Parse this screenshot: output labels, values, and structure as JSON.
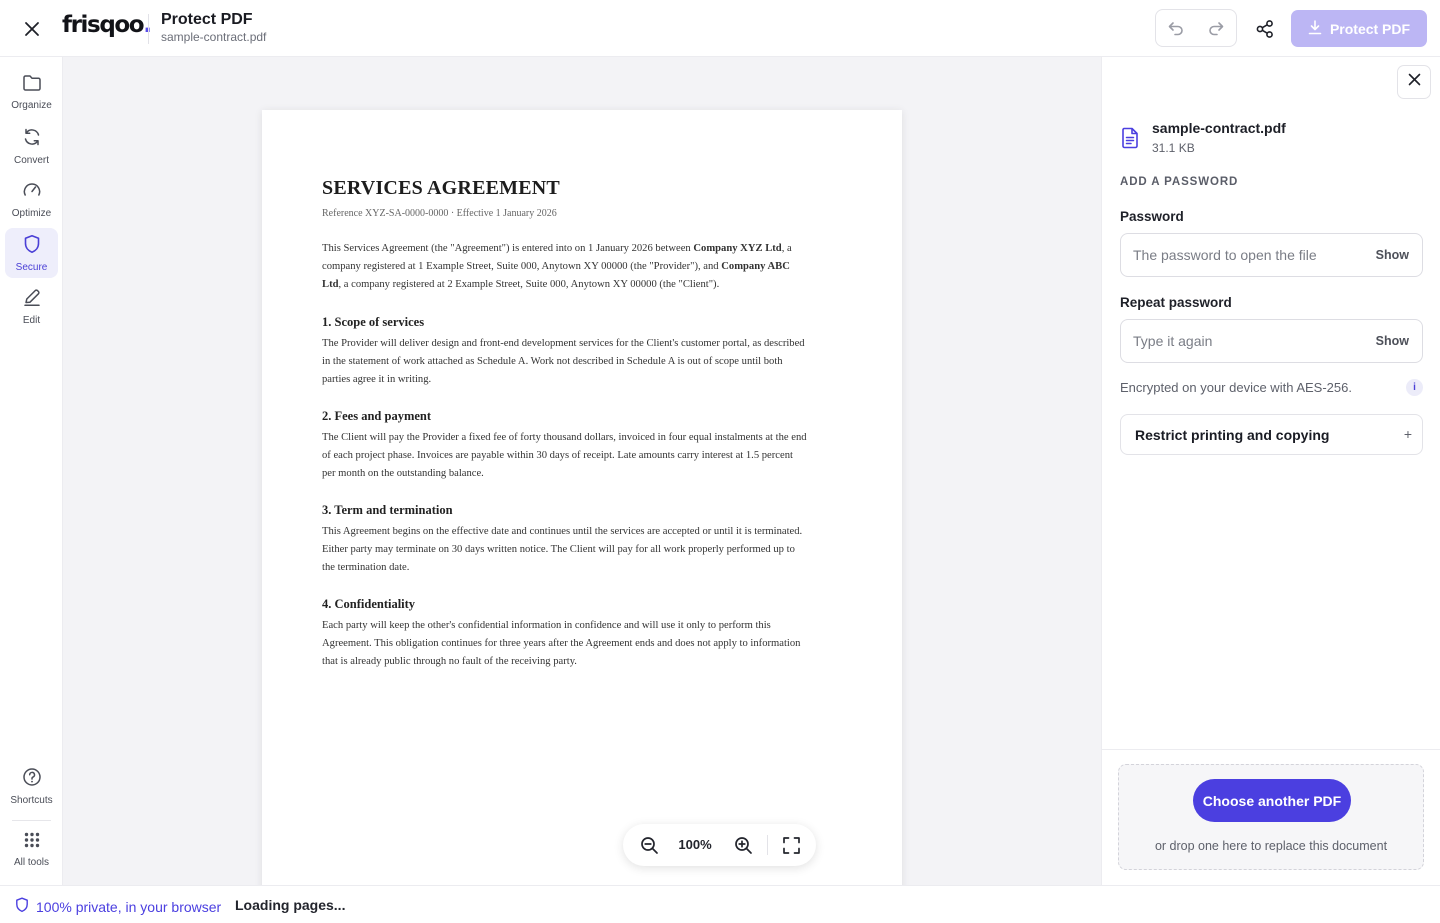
{
  "header": {
    "logo": "frisqoo",
    "title": "Protect PDF",
    "subtitle": "sample-contract.pdf",
    "primary_action": "Protect PDF",
    "icons": [
      "close-icon",
      "undo-icon",
      "redo-icon",
      "share-icon",
      "download-icon"
    ]
  },
  "rail": {
    "items": [
      {
        "label": "Organize",
        "icon": "folder-icon"
      },
      {
        "label": "Convert",
        "icon": "refresh-icon"
      },
      {
        "label": "Optimize",
        "icon": "gauge-icon"
      },
      {
        "label": "Secure",
        "icon": "shield-icon",
        "active": true
      },
      {
        "label": "Edit",
        "icon": "pencil-icon"
      }
    ],
    "bottom": [
      {
        "label": "Shortcuts",
        "icon": "help-circle-icon"
      },
      {
        "label": "All tools",
        "icon": "grid-icon"
      }
    ]
  },
  "document": {
    "title": "SERVICES AGREEMENT",
    "reference": "Reference XYZ-SA-0000-0000 · Effective 1 January 2026",
    "intro_lines": [
      [
        "This Services Agreement (the \"Agreement\") is entered into on 1 January 2026 between ",
        "Company XYZ Ltd",
        ", a"
      ],
      [
        "company registered at 1 Example Street, Suite 000, Anytown XY 00000 (the \"Provider\"), and ",
        "Company ABC",
        ""
      ],
      [
        "",
        "Ltd",
        ", a company registered at 2 Example Street, Suite 000, Anytown XY 00000 (the \"Client\")."
      ]
    ],
    "sections": [
      {
        "heading": "1. Scope of services",
        "lines": [
          "The Provider will deliver design and front-end development services for the Client's customer portal, as described",
          "in the statement of work attached as Schedule A. Work not described in Schedule A is out of scope until both",
          "parties agree it in writing."
        ]
      },
      {
        "heading": "2. Fees and payment",
        "lines": [
          "The Client will pay the Provider a fixed fee of forty thousand dollars, invoiced in four equal instalments at the end",
          "of each project phase. Invoices are payable within 30 days of receipt. Late amounts carry interest at 1.5 percent",
          "per month on the outstanding balance."
        ]
      },
      {
        "heading": "3. Term and termination",
        "lines": [
          "This Agreement begins on the effective date and continues until the services are accepted or until it is terminated.",
          "Either party may terminate on 30 days written notice. The Client will pay for all work properly performed up to",
          "the termination date."
        ]
      },
      {
        "heading": "4. Confidentiality",
        "lines": [
          "Each party will keep the other's confidential information in confidence and will use it only to perform this",
          "Agreement. This obligation continues for three years after the Agreement ends and does not apply to information",
          "that is already public through no fault of the receiving party."
        ]
      }
    ]
  },
  "zoom": {
    "level": "100%",
    "icons": [
      "zoom-out-icon",
      "zoom-in-icon",
      "fullscreen-icon"
    ]
  },
  "panel": {
    "file_name": "sample-contract.pdf",
    "file_size": "31.1 KB",
    "section_title": "ADD A PASSWORD",
    "password_label": "Password",
    "password_placeholder": "The password to open the file",
    "repeat_label": "Repeat password",
    "repeat_placeholder": "Type it again",
    "show_label": "Show",
    "encryption_note": "Encrypted on your device with AES-256.",
    "info_glyph": "i",
    "restrict_label": "Restrict printing and copying",
    "restrict_toggle": "+",
    "choose_button": "Choose another PDF",
    "drop_hint": "or drop one here to replace this document"
  },
  "status": {
    "privacy": "100% private, in your browser",
    "loading": "Loading pages..."
  },
  "colors": {
    "accent": "#4b3fe0",
    "accent_disabled": "#bcb6f4",
    "active_bg": "#eeeefb"
  }
}
